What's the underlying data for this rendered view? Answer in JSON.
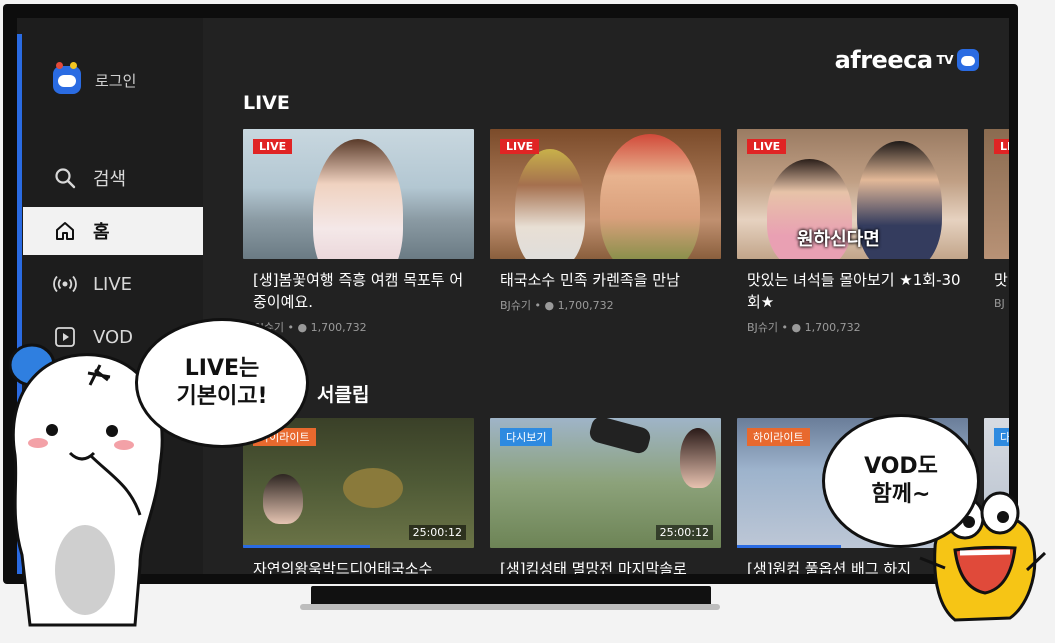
{
  "sidebar": {
    "login_label": "로그인",
    "items": [
      {
        "label": "검색",
        "icon": "search-icon"
      },
      {
        "label": "홈",
        "icon": "home-icon",
        "active": true
      },
      {
        "label": "LIVE",
        "icon": "broadcast-icon"
      },
      {
        "label": "VOD",
        "icon": "play-icon"
      }
    ]
  },
  "brand": {
    "name": "afreeca",
    "superscript": "TV"
  },
  "live_section": {
    "title": "LIVE",
    "cards": [
      {
        "badge": "LIVE",
        "title": "[생]봄꽃여행 즉흥 여캠 목포투 어중이예요.",
        "meta_prefix": "BJ슈기 • ",
        "viewers": "1,700,732"
      },
      {
        "badge": "LIVE",
        "title": "태국소수 민족 카렌족을 만남",
        "meta_prefix": "BJ슈기 • ",
        "viewers": "1,700,732"
      },
      {
        "badge": "LIVE",
        "title": "맛있는 녀석들 몰아보기 ★1회-30회★",
        "meta_prefix": "BJ슈기 • ",
        "viewers": "1,700,732",
        "caption": "원하신다면"
      }
    ],
    "partial_card": {
      "badge": "LI",
      "title": "맛 회",
      "meta": "BJ"
    }
  },
  "clip_section": {
    "title": "하이라이트 / 다시보기 클립",
    "visible_title": "서클립",
    "cards": [
      {
        "badge": "하이라이트",
        "badge_type": "hl",
        "title": "자연의왕욱박드디어태국소수",
        "duration": "25:00:12",
        "progress": 0.55
      },
      {
        "badge": "다시보기",
        "badge_type": "rp",
        "title": "[생]킴성태 멸망전 마지막솔로",
        "duration": "25:00:12",
        "progress": 0.0
      },
      {
        "badge": "하이라이트",
        "badge_type": "hl",
        "title": "[생]원컴 풀옵션 배그 하지",
        "duration": "",
        "progress": 0.45
      }
    ],
    "partial_card": {
      "badge": "다"
    }
  },
  "bubbles": {
    "left": "LIVE는\n기본이고!",
    "right": "VOD도\n함께~"
  },
  "colors": {
    "accent": "#2a6be2",
    "live_badge": "#e02424",
    "highlight_badge": "#e8692e",
    "replay_badge": "#2e8ae0",
    "screen_bg": "#222222"
  }
}
